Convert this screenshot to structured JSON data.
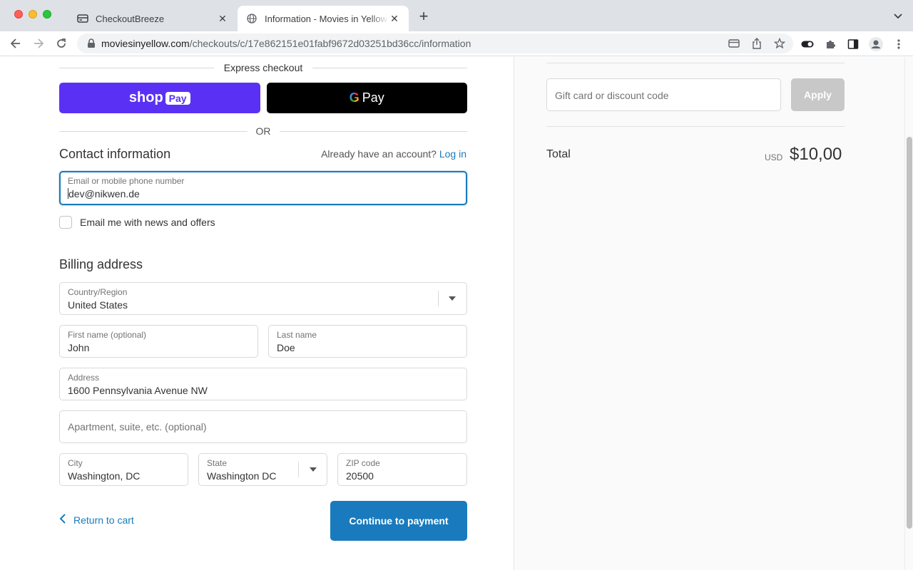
{
  "browser": {
    "tabs": [
      {
        "title": "CheckoutBreeze",
        "favicon": "card-icon",
        "active": false
      },
      {
        "title": "Information - Movies in Yellow",
        "favicon": "globe-icon",
        "active": true
      }
    ],
    "url_host": "moviesinyellow.com",
    "url_path": "/checkouts/c/17e862151e01fabf9672d03251bd36cc/information"
  },
  "express": {
    "title": "Express checkout",
    "shop_pay_text": "shop",
    "shop_pay_box": "Pay",
    "gpay_g": "G",
    "gpay_text": "Pay",
    "or_text": "OR"
  },
  "contact": {
    "title": "Contact information",
    "account_prompt": "Already have an account?",
    "login_link": "Log in",
    "email_label": "Email or mobile phone number",
    "email_value": "dev@nikwen.de",
    "newsletter_label": "Email me with news and offers",
    "newsletter_checked": false
  },
  "billing": {
    "title": "Billing address",
    "country_label": "Country/Region",
    "country_value": "United States",
    "first_name_label": "First name (optional)",
    "first_name_value": "John",
    "last_name_label": "Last name",
    "last_name_value": "Doe",
    "address_label": "Address",
    "address_value": "1600 Pennsylvania Avenue NW",
    "apartment_placeholder": "Apartment, suite, etc. (optional)",
    "city_label": "City",
    "city_value": "Washington, DC",
    "state_label": "State",
    "state_value": "Washington DC",
    "zip_label": "ZIP code",
    "zip_value": "20500"
  },
  "actions": {
    "return_label": "Return to cart",
    "continue_label": "Continue to payment"
  },
  "summary": {
    "discount_placeholder": "Gift card or discount code",
    "apply_label": "Apply",
    "total_label": "Total",
    "currency": "USD",
    "total_amount": "$10,00"
  },
  "colors": {
    "accent": "#197bbd",
    "shop_pay": "#5a31f4",
    "apply_disabled": "#c8c8c8"
  }
}
